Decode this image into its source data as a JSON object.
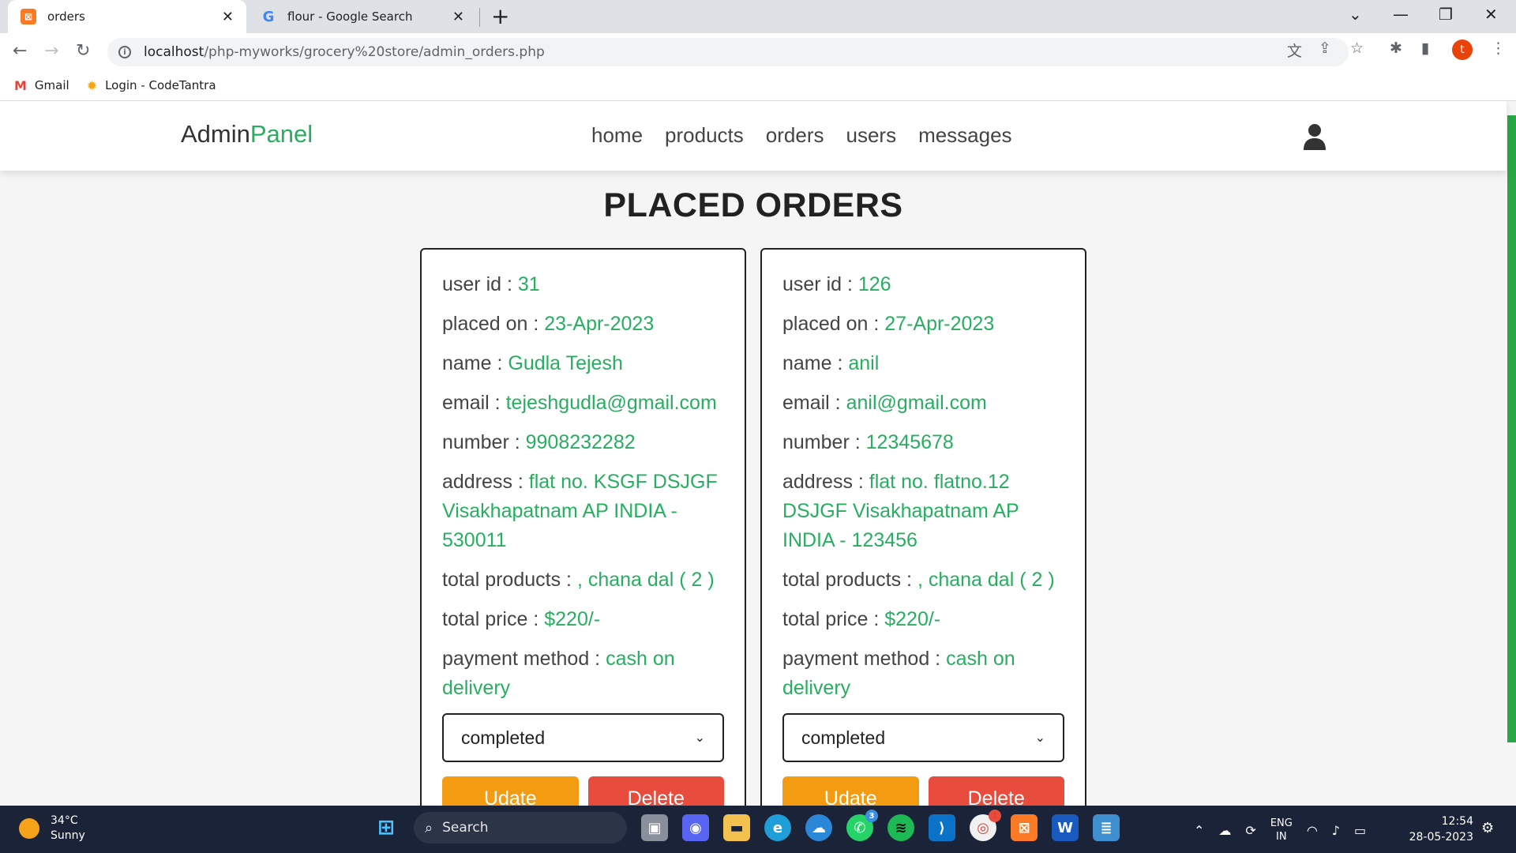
{
  "browser": {
    "tabs": [
      {
        "title": "orders",
        "active": true,
        "icon": "xampp-icon"
      },
      {
        "title": "flour - Google Search",
        "active": false,
        "icon": "google-icon"
      }
    ],
    "url_host": "localhost",
    "url_path": "/php-myworks/grocery%20store/admin_orders.php",
    "profile_initial": "t",
    "bookmarks": [
      {
        "label": "Gmail",
        "icon": "gmail-icon"
      },
      {
        "label": "Login - CodeTantra",
        "icon": "codetantra-icon"
      }
    ]
  },
  "header": {
    "logo_main": "Admin",
    "logo_accent": "Panel",
    "nav": [
      "home",
      "products",
      "orders",
      "users",
      "messages"
    ]
  },
  "page": {
    "title": "PLACED ORDERS"
  },
  "labels": {
    "user_id": "user id : ",
    "placed_on": "placed on : ",
    "name": "name : ",
    "email": "email : ",
    "number": "number : ",
    "address": "address : ",
    "total_products": "total products : ",
    "total_price": "total price : ",
    "payment_method": "payment method : ",
    "update": "Udate",
    "delete": "Delete"
  },
  "orders": [
    {
      "user_id": "31",
      "placed_on": "23-Apr-2023",
      "name": "Gudla Tejesh",
      "email": "tejeshgudla@gmail.com",
      "number": "9908232282",
      "address": "flat no. KSGF DSJGF Visakhapatnam AP INDIA - 530011",
      "total_products": ", chana dal ( 2 )",
      "total_price": "$220/-",
      "payment_method": "cash on delivery",
      "status": "completed"
    },
    {
      "user_id": "126",
      "placed_on": "27-Apr-2023",
      "name": "anil",
      "email": "anil@gmail.com",
      "number": "12345678",
      "address": "flat no. flatno.12 DSJGF Visakhapatnam AP INDIA - 123456",
      "total_products": ", chana dal ( 2 )",
      "total_price": "$220/-",
      "payment_method": "cash on delivery",
      "status": "completed"
    }
  ],
  "taskbar": {
    "temperature": "34°C",
    "weather": "Sunny",
    "search_label": "Search",
    "lang_top": "ENG",
    "lang_bottom": "IN",
    "time": "12:54",
    "date": "28-05-2023",
    "whatsapp_badge": "3",
    "chrome_badge": "1"
  }
}
